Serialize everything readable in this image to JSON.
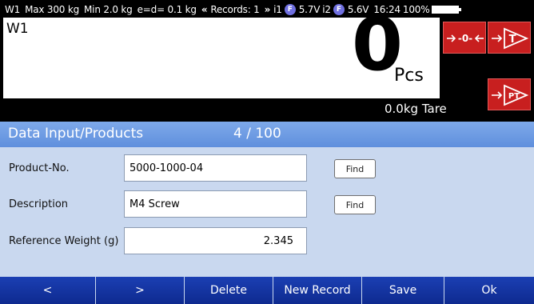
{
  "status_bar": {
    "channel": "W1",
    "max": "Max 300 kg",
    "min": "Min 2.0 kg",
    "division": "e=d= 0.1 kg",
    "records_prev": "«",
    "records_label": "Records: 1",
    "records_next": "»",
    "input1_label": "i1",
    "input1_icon": "F",
    "input1_value": "5.7V",
    "input2_label": "i2",
    "input2_icon": "F",
    "input2_value": "5.6V",
    "time": "16:24",
    "battery": "100%"
  },
  "display": {
    "channel": "W1",
    "weight_value": "0",
    "unit": "Pcs",
    "tare": "0.0kg Tare"
  },
  "keys": {
    "zero": "-0-",
    "tare": "T",
    "preset_tare": "PT"
  },
  "section": {
    "title": "Data Input/Products",
    "record_counter": "4 / 100"
  },
  "form": {
    "product_no_label": "Product-No.",
    "product_no_value": "5000-1000-04",
    "product_find_label": "Find",
    "description_label": "Description",
    "description_value": "M4 Screw",
    "description_find_label": "Find",
    "ref_weight_label": "Reference Weight (g)",
    "ref_weight_value": "2.345"
  },
  "buttons": {
    "prev": "<",
    "next": ">",
    "delete": "Delete",
    "new_record": "New Record",
    "save": "Save",
    "ok": "Ok"
  },
  "colors": {
    "display_bg": "#000000",
    "key_red": "#c81f1f",
    "section_bar": "#6d9ae3",
    "form_bg": "#c9d8ef",
    "button_blue": "#14339f"
  }
}
